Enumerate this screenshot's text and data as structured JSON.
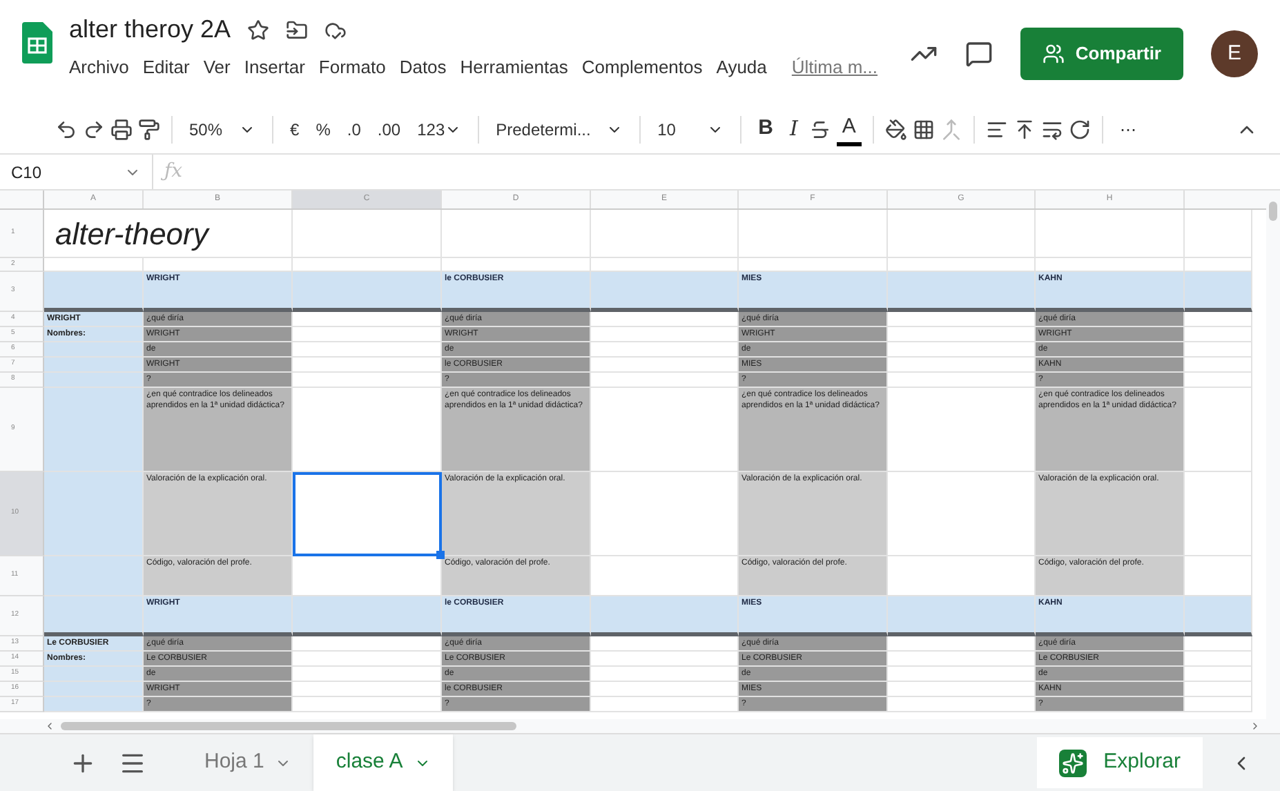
{
  "doc": {
    "title": "alter theroy 2A",
    "menu": [
      "Archivo",
      "Editar",
      "Ver",
      "Insertar",
      "Formato",
      "Datos",
      "Herramientas",
      "Complementos",
      "Ayuda"
    ],
    "last_edit": "Última m...",
    "share": "Compartir",
    "avatar": "E"
  },
  "toolbar": {
    "zoom": "50%",
    "currency": "€",
    "percent": "%",
    "dec_less": ".0",
    "dec_more": ".00",
    "format": "123",
    "font": "Predetermi...",
    "size": "10",
    "bold": "B",
    "italic": "I",
    "text_color": "A",
    "more": "⋯"
  },
  "formula_bar": {
    "name_box": "C10",
    "fx": "ƒx"
  },
  "grid": {
    "columns": [
      {
        "label": "A",
        "selected": false
      },
      {
        "label": "B",
        "selected": false
      },
      {
        "label": "C",
        "selected": true
      },
      {
        "label": "D",
        "selected": false
      },
      {
        "label": "E",
        "selected": false
      },
      {
        "label": "F",
        "selected": false
      },
      {
        "label": "G",
        "selected": false
      },
      {
        "label": "H",
        "selected": false
      }
    ],
    "rows": [
      {
        "number": "1",
        "kind": "title",
        "selected": false,
        "cells": [
          {
            "kind": "title",
            "text": "alter-theory"
          },
          {
            "kind": "white"
          },
          {
            "kind": "white"
          },
          {
            "kind": "white"
          },
          {
            "kind": "white"
          },
          {
            "kind": "white"
          },
          {
            "kind": "white"
          },
          {
            "kind": "white"
          }
        ]
      },
      {
        "number": "2",
        "kind": "spacer",
        "selected": false,
        "cells": [
          {
            "kind": "white"
          },
          {
            "kind": "white"
          },
          {
            "kind": "white"
          },
          {
            "kind": "white"
          },
          {
            "kind": "white"
          },
          {
            "kind": "white"
          },
          {
            "kind": "white"
          },
          {
            "kind": "white"
          },
          {
            "kind": "white"
          }
        ]
      },
      {
        "number": "3",
        "kind": "section",
        "selected": false,
        "cells": [
          {
            "kind": "blue"
          },
          {
            "kind": "heading",
            "text": "WRIGHT"
          },
          {
            "kind": "blue"
          },
          {
            "kind": "heading",
            "text": "le CORBUSIER"
          },
          {
            "kind": "blue"
          },
          {
            "kind": "heading",
            "text": "MIES"
          },
          {
            "kind": "blue"
          },
          {
            "kind": "heading",
            "text": "KAHN"
          },
          {
            "kind": "blue"
          }
        ]
      },
      {
        "number": "4",
        "kind": "line",
        "selected": false,
        "cells": [
          {
            "kind": "label",
            "text": "WRIGHT"
          },
          {
            "kind": "dark",
            "text": "¿qué diría"
          },
          {
            "kind": "white"
          },
          {
            "kind": "dark",
            "text": "¿qué diría"
          },
          {
            "kind": "white"
          },
          {
            "kind": "dark",
            "text": "¿qué diría"
          },
          {
            "kind": "white"
          },
          {
            "kind": "dark",
            "text": "¿qué diría"
          },
          {
            "kind": "white"
          }
        ]
      },
      {
        "number": "5",
        "kind": "line",
        "selected": false,
        "cells": [
          {
            "kind": "label",
            "text": "Nombres:"
          },
          {
            "kind": "dark",
            "text": "WRIGHT"
          },
          {
            "kind": "white"
          },
          {
            "kind": "dark",
            "text": "WRIGHT"
          },
          {
            "kind": "white"
          },
          {
            "kind": "dark",
            "text": "WRIGHT"
          },
          {
            "kind": "white"
          },
          {
            "kind": "dark",
            "text": "WRIGHT"
          },
          {
            "kind": "white"
          }
        ]
      },
      {
        "number": "6",
        "kind": "line",
        "selected": false,
        "cells": [
          {
            "kind": "blue"
          },
          {
            "kind": "dark",
            "text": "de"
          },
          {
            "kind": "white"
          },
          {
            "kind": "dark",
            "text": "de"
          },
          {
            "kind": "white"
          },
          {
            "kind": "dark",
            "text": "de"
          },
          {
            "kind": "white"
          },
          {
            "kind": "dark",
            "text": "de"
          },
          {
            "kind": "white"
          }
        ]
      },
      {
        "number": "7",
        "kind": "line",
        "selected": false,
        "cells": [
          {
            "kind": "blue"
          },
          {
            "kind": "dark",
            "text": "WRIGHT"
          },
          {
            "kind": "white"
          },
          {
            "kind": "dark",
            "text": "le CORBUSIER"
          },
          {
            "kind": "white"
          },
          {
            "kind": "dark",
            "text": "MIES"
          },
          {
            "kind": "white"
          },
          {
            "kind": "dark",
            "text": "KAHN"
          },
          {
            "kind": "white"
          }
        ]
      },
      {
        "number": "8",
        "kind": "line",
        "selected": false,
        "cells": [
          {
            "kind": "blue"
          },
          {
            "kind": "dark",
            "text": "?"
          },
          {
            "kind": "white"
          },
          {
            "kind": "dark",
            "text": "?"
          },
          {
            "kind": "white"
          },
          {
            "kind": "dark",
            "text": "?"
          },
          {
            "kind": "white"
          },
          {
            "kind": "dark",
            "text": "?"
          },
          {
            "kind": "white"
          }
        ]
      },
      {
        "number": "9",
        "kind": "tall",
        "selected": false,
        "cells": [
          {
            "kind": "blue"
          },
          {
            "kind": "medium",
            "text": "¿en qué contradice los delineados aprendidos en la 1ª unidad didáctica?"
          },
          {
            "kind": "white"
          },
          {
            "kind": "medium",
            "text": "¿en qué contradice los delineados aprendidos en la 1ª unidad didáctica?"
          },
          {
            "kind": "white"
          },
          {
            "kind": "medium",
            "text": "¿en qué contradice los delineados aprendidos en la 1ª unidad didáctica?"
          },
          {
            "kind": "white"
          },
          {
            "kind": "medium",
            "text": "¿en qué contradice los delineados aprendidos en la 1ª unidad didáctica?"
          },
          {
            "kind": "white"
          }
        ]
      },
      {
        "number": "10",
        "kind": "tall",
        "selected": true,
        "cells": [
          {
            "kind": "blue"
          },
          {
            "kind": "light",
            "text": "Valoración de la explicación oral."
          },
          {
            "kind": "white"
          },
          {
            "kind": "light",
            "text": "Valoración de la explicación oral."
          },
          {
            "kind": "white"
          },
          {
            "kind": "light",
            "text": "Valoración de la explicación oral."
          },
          {
            "kind": "white"
          },
          {
            "kind": "light",
            "text": "Valoración de la explicación oral."
          },
          {
            "kind": "white"
          }
        ]
      },
      {
        "number": "11",
        "kind": "note",
        "selected": false,
        "cells": [
          {
            "kind": "blue"
          },
          {
            "kind": "light",
            "text": "Código, valoración del  profe."
          },
          {
            "kind": "white"
          },
          {
            "kind": "light",
            "text": "Código, valoración del  profe."
          },
          {
            "kind": "white"
          },
          {
            "kind": "light",
            "text": "Código, valoración del  profe."
          },
          {
            "kind": "white"
          },
          {
            "kind": "light",
            "text": "Código, valoración del  profe."
          },
          {
            "kind": "white"
          }
        ]
      },
      {
        "number": "12",
        "kind": "section",
        "selected": false,
        "cells": [
          {
            "kind": "blue"
          },
          {
            "kind": "heading",
            "text": "WRIGHT"
          },
          {
            "kind": "blue"
          },
          {
            "kind": "heading",
            "text": "le CORBUSIER"
          },
          {
            "kind": "blue"
          },
          {
            "kind": "heading",
            "text": "MIES"
          },
          {
            "kind": "blue"
          },
          {
            "kind": "heading",
            "text": "KAHN"
          },
          {
            "kind": "blue"
          }
        ]
      },
      {
        "number": "13",
        "kind": "line",
        "selected": false,
        "cells": [
          {
            "kind": "label",
            "text": "Le CORBUSIER"
          },
          {
            "kind": "dark",
            "text": "¿qué diría"
          },
          {
            "kind": "white"
          },
          {
            "kind": "dark",
            "text": "¿qué diría"
          },
          {
            "kind": "white"
          },
          {
            "kind": "dark",
            "text": "¿qué diría"
          },
          {
            "kind": "white"
          },
          {
            "kind": "dark",
            "text": "¿qué diría"
          },
          {
            "kind": "white"
          }
        ]
      },
      {
        "number": "14",
        "kind": "line",
        "selected": false,
        "cells": [
          {
            "kind": "label",
            "text": "Nombres:"
          },
          {
            "kind": "dark",
            "text": "Le CORBUSIER"
          },
          {
            "kind": "white"
          },
          {
            "kind": "dark",
            "text": "Le CORBUSIER"
          },
          {
            "kind": "white"
          },
          {
            "kind": "dark",
            "text": "Le CORBUSIER"
          },
          {
            "kind": "white"
          },
          {
            "kind": "dark",
            "text": "Le CORBUSIER"
          },
          {
            "kind": "white"
          }
        ]
      },
      {
        "number": "15",
        "kind": "line",
        "selected": false,
        "cells": [
          {
            "kind": "blue"
          },
          {
            "kind": "dark",
            "text": "de"
          },
          {
            "kind": "white"
          },
          {
            "kind": "dark",
            "text": "de"
          },
          {
            "kind": "white"
          },
          {
            "kind": "dark",
            "text": "de"
          },
          {
            "kind": "white"
          },
          {
            "kind": "dark",
            "text": "de"
          },
          {
            "kind": "white"
          }
        ]
      },
      {
        "number": "16",
        "kind": "line",
        "selected": false,
        "cells": [
          {
            "kind": "blue"
          },
          {
            "kind": "dark",
            "text": "WRIGHT"
          },
          {
            "kind": "white"
          },
          {
            "kind": "dark",
            "text": "le CORBUSIER"
          },
          {
            "kind": "white"
          },
          {
            "kind": "dark",
            "text": "MIES"
          },
          {
            "kind": "white"
          },
          {
            "kind": "dark",
            "text": "KAHN"
          },
          {
            "kind": "white"
          }
        ]
      },
      {
        "number": "17",
        "kind": "line",
        "selected": false,
        "cells": [
          {
            "kind": "blue"
          },
          {
            "kind": "dark",
            "text": "?"
          },
          {
            "kind": "white"
          },
          {
            "kind": "dark",
            "text": "?"
          },
          {
            "kind": "white"
          },
          {
            "kind": "dark",
            "text": "?"
          },
          {
            "kind": "white"
          },
          {
            "kind": "dark",
            "text": "?"
          },
          {
            "kind": "white"
          }
        ]
      }
    ]
  },
  "sheet_tabs": [
    {
      "label": "Hoja 1",
      "selected": false
    },
    {
      "label": "clase A",
      "selected": true
    }
  ],
  "explore": {
    "label": "Explorar"
  }
}
